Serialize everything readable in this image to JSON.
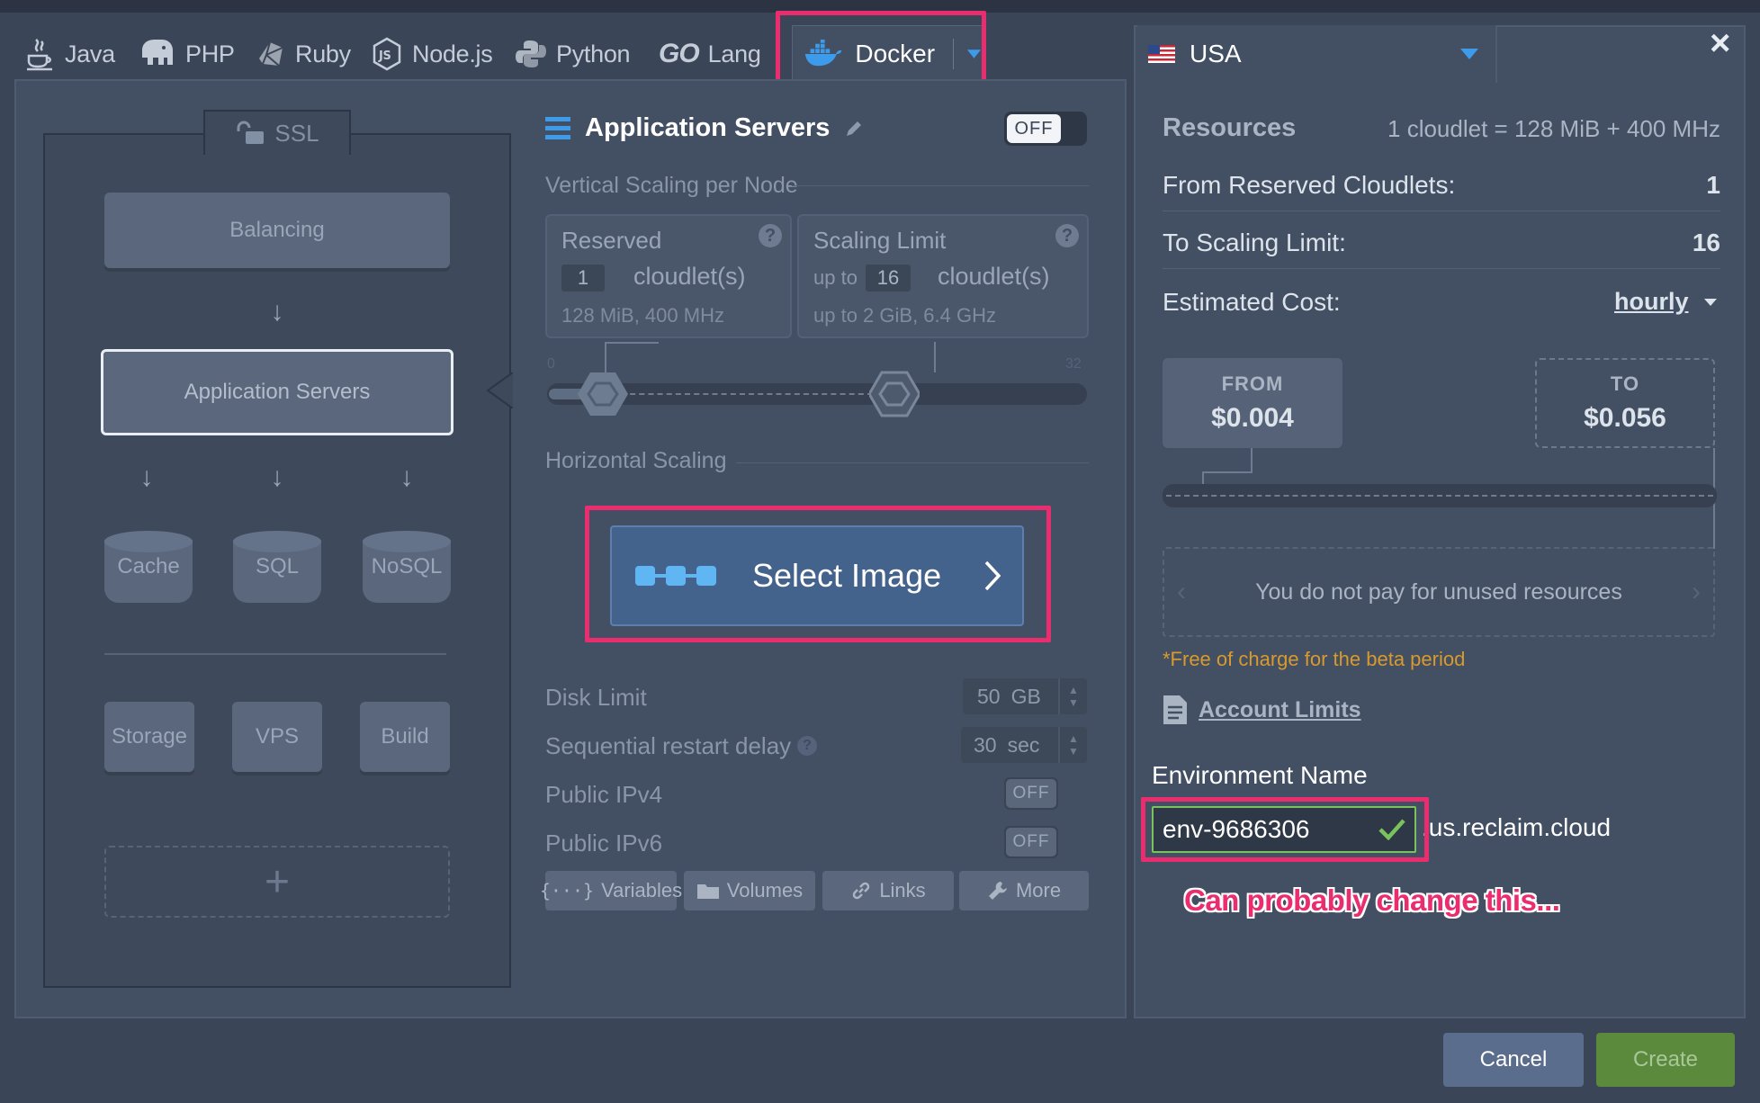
{
  "tabs": [
    {
      "label": "Java",
      "icon": "java-icon"
    },
    {
      "label": "PHP",
      "icon": "php-elephant-icon"
    },
    {
      "label": "Ruby",
      "icon": "ruby-icon"
    },
    {
      "label": "Node.js",
      "icon": "nodejs-icon"
    },
    {
      "label": "Python",
      "icon": "python-icon"
    },
    {
      "label": "Lang",
      "logo_text": "GO",
      "icon": "go-icon"
    },
    {
      "label": "Docker",
      "icon": "docker-icon",
      "active": true
    }
  ],
  "region": {
    "label": "USA",
    "icon": "us-flag-icon"
  },
  "topology": {
    "ssl_label": "SSL",
    "balancing": "Balancing",
    "app_servers": "Application Servers",
    "cache": "Cache",
    "sql": "SQL",
    "nosql": "NoSQL",
    "storage": "Storage",
    "vps": "VPS",
    "build": "Build",
    "add": "+"
  },
  "app": {
    "title": "Application Servers",
    "toggle": "OFF",
    "vertical_label": "Vertical Scaling per Node",
    "reserved": {
      "title": "Reserved",
      "value": "1",
      "unit": "cloudlet(s)",
      "detail": "128 MiB, 400 MHz",
      "help": "?"
    },
    "scaling": {
      "title": "Scaling Limit",
      "prefix": "up to",
      "value": "16",
      "unit": "cloudlet(s)",
      "detail": "up to 2 GiB, 6.4 GHz",
      "help": "?"
    },
    "slider": {
      "min": "0",
      "max": "32",
      "reserved": 1,
      "limit": 16
    },
    "horizontal_label": "Horizontal Scaling",
    "select_image": "Select Image",
    "disk": {
      "label": "Disk Limit",
      "value": "50",
      "unit": "GB"
    },
    "restart": {
      "label": "Sequential restart delay",
      "value": "30",
      "unit": "sec",
      "help": "?"
    },
    "ipv4": {
      "label": "Public IPv4",
      "toggle": "OFF"
    },
    "ipv6": {
      "label": "Public IPv6",
      "toggle": "OFF"
    },
    "buttons": {
      "variables": "Variables",
      "volumes": "Volumes",
      "links": "Links",
      "more": "More"
    }
  },
  "resources": {
    "title": "Resources",
    "formula": "1 cloudlet = 128 MiB + 400 MHz",
    "from_label": "From Reserved Cloudlets:",
    "from_value": "1",
    "to_label": "To Scaling Limit:",
    "to_value": "16",
    "cost_label": "Estimated Cost:",
    "cost_period": "hourly",
    "from_box": {
      "label": "FROM",
      "value": "$0.004"
    },
    "to_box": {
      "label": "TO",
      "value": "$0.056"
    },
    "unused_note": "You do not pay for unused resources",
    "beta_note": "*Free of charge for the beta period",
    "account_limits": "Account Limits"
  },
  "environment": {
    "label": "Environment Name",
    "value": "env-9686306",
    "domain": ".us.reclaim.cloud"
  },
  "annotation": "Can probably change this...",
  "footer": {
    "cancel": "Cancel",
    "create": "Create"
  },
  "close": "×",
  "colors": {
    "highlight": "#ea2d6f",
    "accent": "#3d9be9",
    "valid": "#7ac35c",
    "create": "#5b8a3c",
    "cancel": "#5b6d8c",
    "beta_note": "#d89a2c"
  }
}
